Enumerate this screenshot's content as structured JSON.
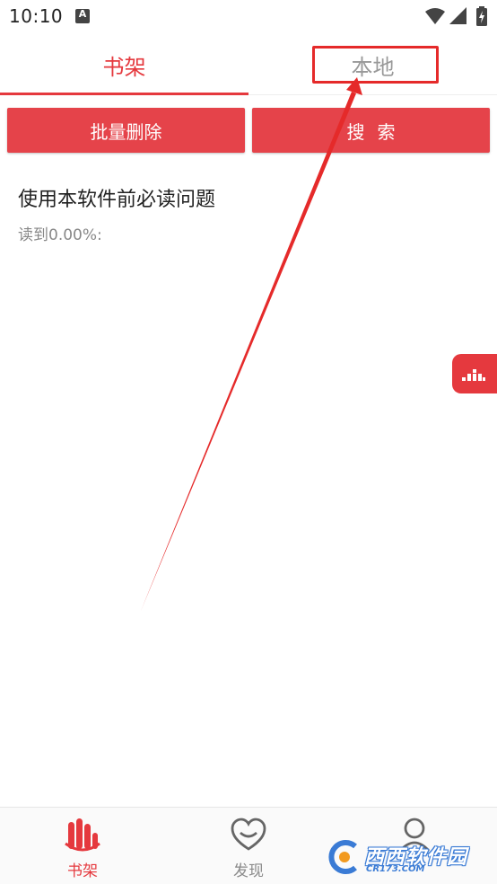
{
  "status_bar": {
    "time": "10:10"
  },
  "top_tabs": [
    {
      "label": "书架",
      "active": true
    },
    {
      "label": "本地",
      "active": false
    }
  ],
  "actions": {
    "batch_delete": "批量删除",
    "search": "搜索"
  },
  "books": [
    {
      "title": "使用本软件前必读问题",
      "progress": "读到0.00%:"
    }
  ],
  "bottom_nav": [
    {
      "label": "书架",
      "icon": "bookshelf-icon",
      "active": true
    },
    {
      "label": "发现",
      "icon": "discover-heart-icon",
      "active": false
    },
    {
      "label": "",
      "icon": "user-profile-icon",
      "active": false
    }
  ],
  "watermark": {
    "text": "西西软件园",
    "sub": "CR173.COM"
  },
  "colors": {
    "accent": "#e5393e",
    "button": "#e5434a",
    "inactive": "#999999",
    "annotation": "#e52a2a"
  }
}
